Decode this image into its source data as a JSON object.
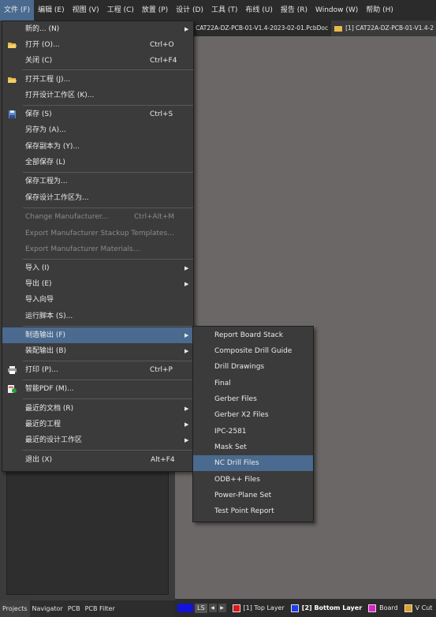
{
  "menubar": {
    "items": [
      "文件 (F)",
      "编辑 (E)",
      "视图 (V)",
      "工程 (C)",
      "放置 (P)",
      "设计 (D)",
      "工具 (T)",
      "布线 (U)",
      "报告 (R)",
      "Window (W)",
      "帮助 (H)"
    ]
  },
  "tabs": [
    {
      "label": "CAT22A-DZ-PCB-01-V1.4-2023-02-01.PcbDoc",
      "active": true
    },
    {
      "label": "[1] CAT22A-DZ-PCB-01-V1.4-2",
      "active": false
    }
  ],
  "file_menu": {
    "items": [
      {
        "label": "新的... (N)",
        "shortcut": "",
        "submenu": true
      },
      {
        "label": "打开 (O)...",
        "shortcut": "Ctrl+O",
        "icon": "open-folder-icon"
      },
      {
        "label": "关闭 (C)",
        "shortcut": "Ctrl+F4"
      },
      {
        "label": "打开工程 (J)...",
        "shortcut": "",
        "icon": "open-project-icon"
      },
      {
        "label": "打开设计工作区 (K)...",
        "shortcut": ""
      },
      {
        "label": "保存 (S)",
        "shortcut": "Ctrl+S",
        "icon": "save-icon"
      },
      {
        "label": "另存为 (A)...",
        "shortcut": ""
      },
      {
        "label": "保存副本为 (Y)...",
        "shortcut": ""
      },
      {
        "label": "全部保存 (L)",
        "shortcut": ""
      },
      {
        "label": "保存工程为...",
        "shortcut": ""
      },
      {
        "label": "保存设计工作区为...",
        "shortcut": ""
      },
      {
        "label": "Change Manufacturer...",
        "shortcut": "Ctrl+Alt+M",
        "disabled": true
      },
      {
        "label": "Export Manufacturer Stackup Templates...",
        "shortcut": "",
        "disabled": true
      },
      {
        "label": "Export Manufacturer Materials...",
        "shortcut": "",
        "disabled": true
      },
      {
        "label": "导入 (I)",
        "shortcut": "",
        "submenu": true
      },
      {
        "label": "导出 (E)",
        "shortcut": "",
        "submenu": true
      },
      {
        "label": "导入向导",
        "shortcut": ""
      },
      {
        "label": "运行脚本 (S)...",
        "shortcut": ""
      },
      {
        "label": "制造输出 (F)",
        "shortcut": "",
        "submenu": true,
        "highlighted": true
      },
      {
        "label": "装配输出 (B)",
        "shortcut": "",
        "submenu": true
      },
      {
        "label": "打印 (P)...",
        "shortcut": "Ctrl+P",
        "icon": "printer-icon"
      },
      {
        "label": "智能PDF (M)...",
        "shortcut": "",
        "icon": "smart-pdf-icon"
      },
      {
        "label": "最近的文档 (R)",
        "shortcut": "",
        "submenu": true
      },
      {
        "label": "最近的工程",
        "shortcut": "",
        "submenu": true
      },
      {
        "label": "最近的设计工作区",
        "shortcut": "",
        "submenu": true
      },
      {
        "label": "退出 (X)",
        "shortcut": "Alt+F4"
      }
    ]
  },
  "fab_submenu": {
    "items": [
      {
        "label": "Report Board Stack"
      },
      {
        "label": "Composite Drill Guide"
      },
      {
        "label": "Drill Drawings"
      },
      {
        "label": "Final"
      },
      {
        "label": "Gerber Files"
      },
      {
        "label": "Gerber X2 Files"
      },
      {
        "label": "IPC-2581"
      },
      {
        "label": "Mask Set"
      },
      {
        "label": "NC Drill Files",
        "highlighted": true
      },
      {
        "label": "ODB++ Files"
      },
      {
        "label": "Power-Plane Set"
      },
      {
        "label": "Test Point Report"
      }
    ]
  },
  "panel_tabs": [
    "Projects",
    "Navigator",
    "PCB",
    "PCB Filter"
  ],
  "status": {
    "ls_label": "LS",
    "layers": [
      {
        "label": "[1] Top Layer",
        "color": "#e01818",
        "bold": false
      },
      {
        "label": "[2] Bottom Layer",
        "color": "#1e3cf0",
        "bold": true
      },
      {
        "label": "Board",
        "color": "#e020c8",
        "bold": false
      },
      {
        "label": "V Cut",
        "color": "#e0a020",
        "bold": false
      }
    ]
  },
  "colors": {
    "highlight": "#4a6a8f",
    "menu_bg": "#3b3b3b",
    "canvas_bg": "#6b6766"
  }
}
